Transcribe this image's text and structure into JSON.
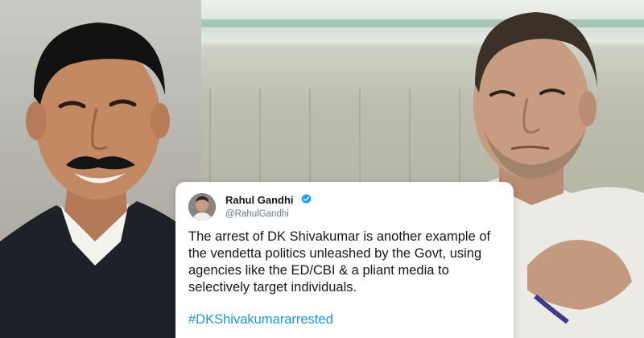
{
  "tweet": {
    "name": "Rahul Gandhi",
    "handle": "@RahulGandhi",
    "text": "The arrest of DK Shivakumar is another example of the vendetta politics unleashed by the Govt, using agencies like the ED/CBI & a pliant media to selectively target individuals.",
    "hashtag": "#DKShivakumararrested",
    "verified": true
  },
  "colors": {
    "hashtag": "#1b95e0",
    "verified_badge": "#1da1f2",
    "text": "#14171a",
    "handle": "#657786"
  },
  "icons": {
    "verified": "verified-badge-icon",
    "avatar": "profile-avatar"
  }
}
